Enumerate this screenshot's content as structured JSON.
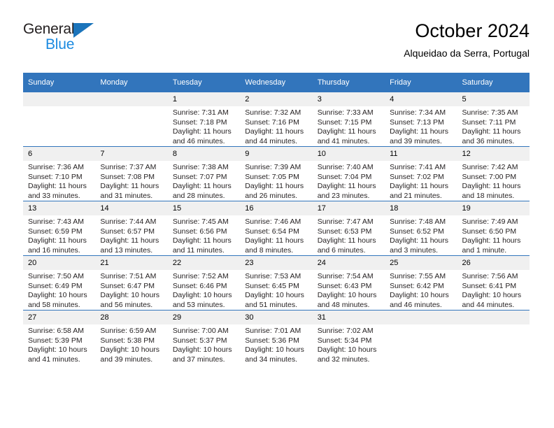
{
  "brand": {
    "name_dark": "General",
    "name_blue": "Blue",
    "triangle_color": "#1b74bb",
    "blue_text_color": "#1b8ae0"
  },
  "header": {
    "title": "October 2024",
    "subtitle": "Alqueidao da Serra, Portugal",
    "accent_color": "#3275bc",
    "daynum_band_color": "#f0f0f0"
  },
  "weekday_headers": [
    "Sunday",
    "Monday",
    "Tuesday",
    "Wednesday",
    "Thursday",
    "Friday",
    "Saturday"
  ],
  "labels": {
    "sunrise_prefix": "Sunrise:",
    "sunset_prefix": "Sunset:",
    "daylight_prefix": "Daylight:"
  },
  "weeks": [
    [
      {
        "day": "",
        "blank": true,
        "sunrise": "",
        "sunset": "",
        "daylight": ""
      },
      {
        "day": "",
        "blank": true,
        "sunrise": "",
        "sunset": "",
        "daylight": ""
      },
      {
        "day": "1",
        "sunrise": "Sunrise: 7:31 AM",
        "sunset": "Sunset: 7:18 PM",
        "daylight": "Daylight: 11 hours and 46 minutes."
      },
      {
        "day": "2",
        "sunrise": "Sunrise: 7:32 AM",
        "sunset": "Sunset: 7:16 PM",
        "daylight": "Daylight: 11 hours and 44 minutes."
      },
      {
        "day": "3",
        "sunrise": "Sunrise: 7:33 AM",
        "sunset": "Sunset: 7:15 PM",
        "daylight": "Daylight: 11 hours and 41 minutes."
      },
      {
        "day": "4",
        "sunrise": "Sunrise: 7:34 AM",
        "sunset": "Sunset: 7:13 PM",
        "daylight": "Daylight: 11 hours and 39 minutes."
      },
      {
        "day": "5",
        "sunrise": "Sunrise: 7:35 AM",
        "sunset": "Sunset: 7:11 PM",
        "daylight": "Daylight: 11 hours and 36 minutes."
      }
    ],
    [
      {
        "day": "6",
        "sunrise": "Sunrise: 7:36 AM",
        "sunset": "Sunset: 7:10 PM",
        "daylight": "Daylight: 11 hours and 33 minutes."
      },
      {
        "day": "7",
        "sunrise": "Sunrise: 7:37 AM",
        "sunset": "Sunset: 7:08 PM",
        "daylight": "Daylight: 11 hours and 31 minutes."
      },
      {
        "day": "8",
        "sunrise": "Sunrise: 7:38 AM",
        "sunset": "Sunset: 7:07 PM",
        "daylight": "Daylight: 11 hours and 28 minutes."
      },
      {
        "day": "9",
        "sunrise": "Sunrise: 7:39 AM",
        "sunset": "Sunset: 7:05 PM",
        "daylight": "Daylight: 11 hours and 26 minutes."
      },
      {
        "day": "10",
        "sunrise": "Sunrise: 7:40 AM",
        "sunset": "Sunset: 7:04 PM",
        "daylight": "Daylight: 11 hours and 23 minutes."
      },
      {
        "day": "11",
        "sunrise": "Sunrise: 7:41 AM",
        "sunset": "Sunset: 7:02 PM",
        "daylight": "Daylight: 11 hours and 21 minutes."
      },
      {
        "day": "12",
        "sunrise": "Sunrise: 7:42 AM",
        "sunset": "Sunset: 7:00 PM",
        "daylight": "Daylight: 11 hours and 18 minutes."
      }
    ],
    [
      {
        "day": "13",
        "sunrise": "Sunrise: 7:43 AM",
        "sunset": "Sunset: 6:59 PM",
        "daylight": "Daylight: 11 hours and 16 minutes."
      },
      {
        "day": "14",
        "sunrise": "Sunrise: 7:44 AM",
        "sunset": "Sunset: 6:57 PM",
        "daylight": "Daylight: 11 hours and 13 minutes."
      },
      {
        "day": "15",
        "sunrise": "Sunrise: 7:45 AM",
        "sunset": "Sunset: 6:56 PM",
        "daylight": "Daylight: 11 hours and 11 minutes."
      },
      {
        "day": "16",
        "sunrise": "Sunrise: 7:46 AM",
        "sunset": "Sunset: 6:54 PM",
        "daylight": "Daylight: 11 hours and 8 minutes."
      },
      {
        "day": "17",
        "sunrise": "Sunrise: 7:47 AM",
        "sunset": "Sunset: 6:53 PM",
        "daylight": "Daylight: 11 hours and 6 minutes."
      },
      {
        "day": "18",
        "sunrise": "Sunrise: 7:48 AM",
        "sunset": "Sunset: 6:52 PM",
        "daylight": "Daylight: 11 hours and 3 minutes."
      },
      {
        "day": "19",
        "sunrise": "Sunrise: 7:49 AM",
        "sunset": "Sunset: 6:50 PM",
        "daylight": "Daylight: 11 hours and 1 minute."
      }
    ],
    [
      {
        "day": "20",
        "sunrise": "Sunrise: 7:50 AM",
        "sunset": "Sunset: 6:49 PM",
        "daylight": "Daylight: 10 hours and 58 minutes."
      },
      {
        "day": "21",
        "sunrise": "Sunrise: 7:51 AM",
        "sunset": "Sunset: 6:47 PM",
        "daylight": "Daylight: 10 hours and 56 minutes."
      },
      {
        "day": "22",
        "sunrise": "Sunrise: 7:52 AM",
        "sunset": "Sunset: 6:46 PM",
        "daylight": "Daylight: 10 hours and 53 minutes."
      },
      {
        "day": "23",
        "sunrise": "Sunrise: 7:53 AM",
        "sunset": "Sunset: 6:45 PM",
        "daylight": "Daylight: 10 hours and 51 minutes."
      },
      {
        "day": "24",
        "sunrise": "Sunrise: 7:54 AM",
        "sunset": "Sunset: 6:43 PM",
        "daylight": "Daylight: 10 hours and 48 minutes."
      },
      {
        "day": "25",
        "sunrise": "Sunrise: 7:55 AM",
        "sunset": "Sunset: 6:42 PM",
        "daylight": "Daylight: 10 hours and 46 minutes."
      },
      {
        "day": "26",
        "sunrise": "Sunrise: 7:56 AM",
        "sunset": "Sunset: 6:41 PM",
        "daylight": "Daylight: 10 hours and 44 minutes."
      }
    ],
    [
      {
        "day": "27",
        "sunrise": "Sunrise: 6:58 AM",
        "sunset": "Sunset: 5:39 PM",
        "daylight": "Daylight: 10 hours and 41 minutes."
      },
      {
        "day": "28",
        "sunrise": "Sunrise: 6:59 AM",
        "sunset": "Sunset: 5:38 PM",
        "daylight": "Daylight: 10 hours and 39 minutes."
      },
      {
        "day": "29",
        "sunrise": "Sunrise: 7:00 AM",
        "sunset": "Sunset: 5:37 PM",
        "daylight": "Daylight: 10 hours and 37 minutes."
      },
      {
        "day": "30",
        "sunrise": "Sunrise: 7:01 AM",
        "sunset": "Sunset: 5:36 PM",
        "daylight": "Daylight: 10 hours and 34 minutes."
      },
      {
        "day": "31",
        "sunrise": "Sunrise: 7:02 AM",
        "sunset": "Sunset: 5:34 PM",
        "daylight": "Daylight: 10 hours and 32 minutes."
      },
      {
        "day": "",
        "blank": true,
        "sunrise": "",
        "sunset": "",
        "daylight": ""
      },
      {
        "day": "",
        "blank": true,
        "sunrise": "",
        "sunset": "",
        "daylight": ""
      }
    ]
  ]
}
